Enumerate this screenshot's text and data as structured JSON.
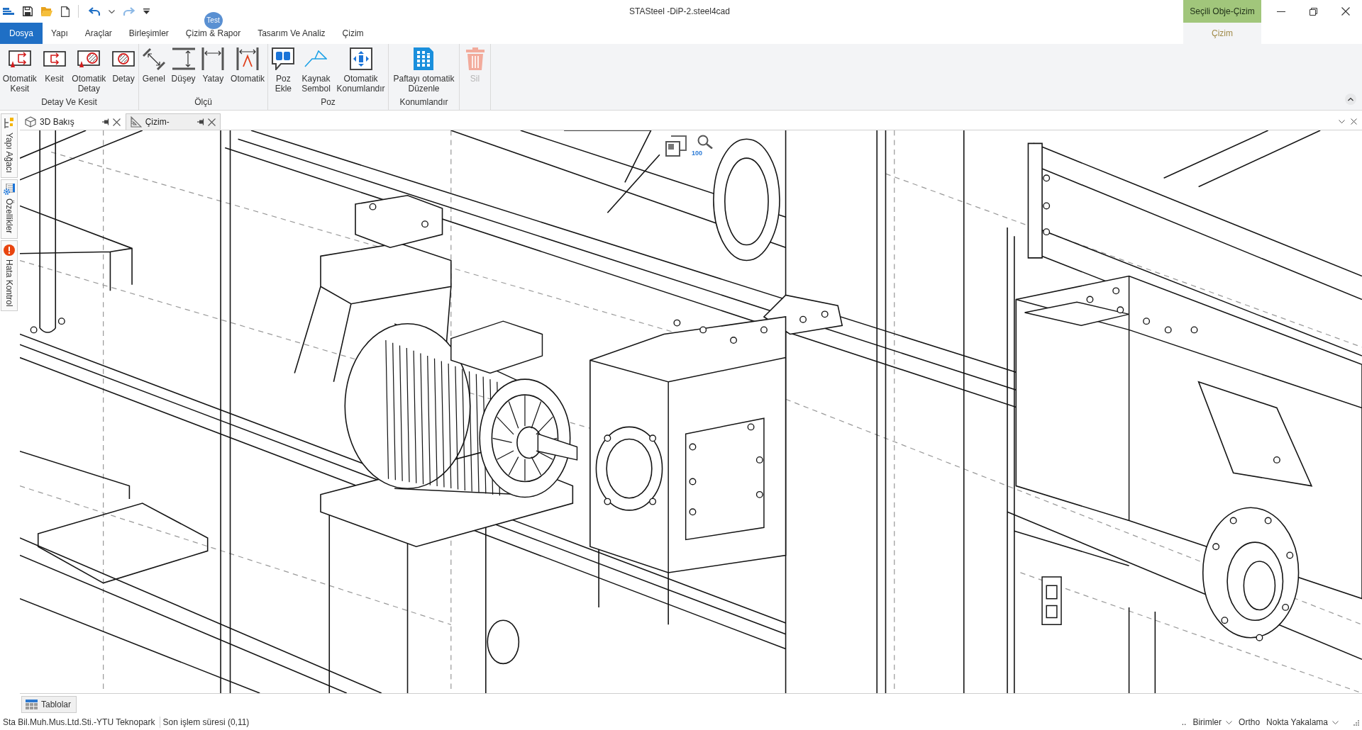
{
  "window": {
    "title": "STASteel -DiP-2.steel4cad"
  },
  "ribbon_tabs": [
    {
      "label": "Dosya",
      "kind": "file",
      "selected": false
    },
    {
      "label": "Yapı",
      "kind": "tab",
      "selected": false
    },
    {
      "label": "Araçlar",
      "kind": "tab",
      "selected": false
    },
    {
      "label": "Birleşimler",
      "kind": "tab",
      "selected": false
    },
    {
      "label": "Çizim & Rapor",
      "kind": "tab",
      "selected": false,
      "badge": "Test"
    },
    {
      "label": "Tasarım Ve Analiz",
      "kind": "tab",
      "selected": false
    },
    {
      "label": "Çizim",
      "kind": "tab",
      "selected": false
    }
  ],
  "contextual_tabs": {
    "group": "Seçili Obje-Çizim",
    "tabs": [
      {
        "label": "Çizim",
        "selected": true
      }
    ]
  },
  "ribbon_groups": [
    {
      "label": "Detay Ve Kesit",
      "buttons": [
        {
          "kind": "auto-section",
          "lines": [
            "Otomatik",
            "Kesit"
          ],
          "disabled": false
        },
        {
          "kind": "section",
          "lines": [
            "Kesit"
          ],
          "disabled": false
        },
        {
          "kind": "auto-detail",
          "lines": [
            "Otomatik",
            "Detay"
          ],
          "disabled": false
        },
        {
          "kind": "detail",
          "lines": [
            "Detay"
          ],
          "disabled": false
        }
      ]
    },
    {
      "label": "Ölçü",
      "buttons": [
        {
          "kind": "general-dim",
          "lines": [
            "Genel"
          ],
          "disabled": false
        },
        {
          "kind": "vertical-dim",
          "lines": [
            "Düşey"
          ],
          "disabled": false
        },
        {
          "kind": "horizontal-dim",
          "lines": [
            "Yatay"
          ],
          "disabled": false
        },
        {
          "kind": "auto-dim",
          "lines": [
            "Otomatik"
          ],
          "disabled": false
        }
      ]
    },
    {
      "label": "Poz",
      "buttons": [
        {
          "kind": "add-mark",
          "lines": [
            "Poz",
            "Ekle"
          ],
          "disabled": false
        },
        {
          "kind": "weld",
          "lines": [
            "Kaynak",
            "Sembol"
          ],
          "disabled": false
        },
        {
          "kind": "auto-place",
          "lines": [
            "Otomatik",
            "Konumlandır"
          ],
          "disabled": false
        }
      ]
    },
    {
      "label": "Konumlandır",
      "buttons": [
        {
          "kind": "sheet",
          "lines": [
            "Paftayı otomatik",
            "Düzenle"
          ],
          "disabled": false
        }
      ]
    },
    {
      "buttons": [
        {
          "kind": "delete",
          "lines": [
            "Sil"
          ],
          "disabled": true
        }
      ]
    }
  ],
  "side_tabs": [
    {
      "label": "Yapı Ağacı",
      "kind": "tree"
    },
    {
      "label": "Özellikler",
      "kind": "properties"
    },
    {
      "label": "Hata Kontrol",
      "kind": "errors"
    }
  ],
  "document_tabs": [
    {
      "label": "3D Bakış",
      "kind": "model",
      "selected": false
    },
    {
      "label": "Çizim-",
      "kind": "drawing",
      "selected": true
    }
  ],
  "canvas": {
    "zoom_level": "100"
  },
  "bottom_tabs": [
    {
      "label": "Tablolar"
    }
  ],
  "status_bar": {
    "left": [
      "Sta Bil.Muh.Mus.Ltd.Sti.-YTU Teknopark",
      "Son işlem süresi (0,11)"
    ],
    "right": [
      {
        "label": "..",
        "dropdown": false
      },
      {
        "label": "Birimler",
        "dropdown": true
      },
      {
        "label": "Ortho",
        "dropdown": false
      },
      {
        "label": "Nokta Yakalama",
        "dropdown": true
      }
    ]
  }
}
